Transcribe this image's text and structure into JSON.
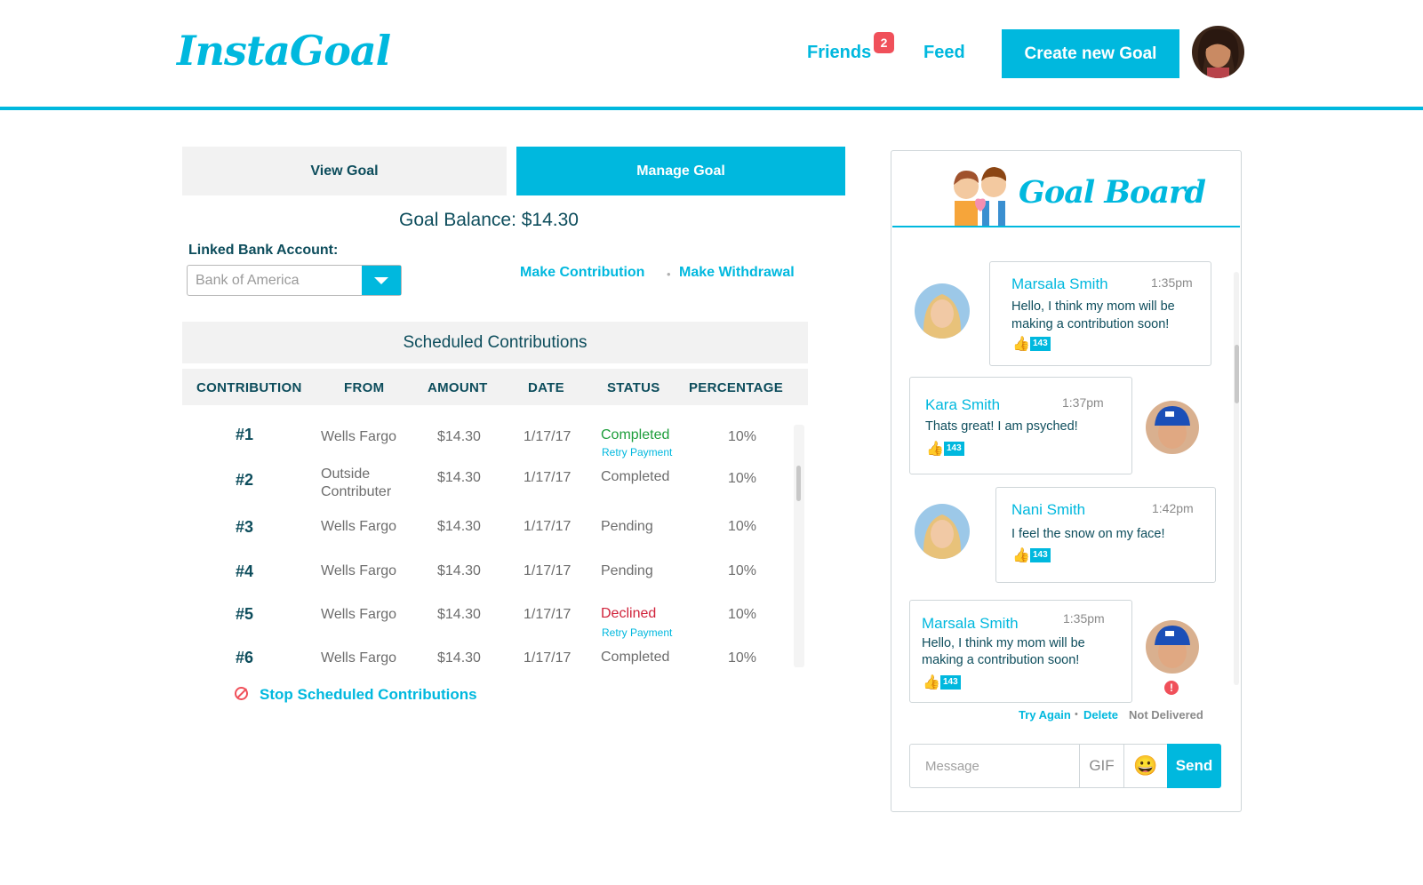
{
  "header": {
    "logo": "InstaGoal",
    "friends_label": "Friends",
    "friends_badge": "2",
    "feed_label": "Feed",
    "create_label": "Create new Goal"
  },
  "tabs": [
    {
      "label": "View Goal",
      "active": false
    },
    {
      "label": "Manage Goal",
      "active": true
    }
  ],
  "goal": {
    "balance": "Goal Balance: $14.30",
    "bank_label": "Linked Bank Account:",
    "bank_value": "Bank of America",
    "make_contribution": "Make Contribution",
    "make_withdrawal": "Make Withdrawal",
    "separator": "•"
  },
  "schedule": {
    "title": "Scheduled Contributions",
    "columns": [
      "CONTRIBUTION",
      "FROM",
      "AMOUNT",
      "DATE",
      "STATUS",
      "PERCENTAGE"
    ],
    "rows": [
      {
        "num": "#1",
        "from": "Wells Fargo",
        "amount": "$14.30",
        "date": "1/17/17",
        "status": "Completed",
        "retry": "Retry Payment",
        "pct": "10%"
      },
      {
        "num": "#2",
        "from_line1": "Outside",
        "from_line2": "Contributer",
        "amount": "$14.30",
        "date": "1/17/17",
        "status": "Completed",
        "pct": "10%"
      },
      {
        "num": "#3",
        "from": "Wells Fargo",
        "amount": "$14.30",
        "date": "1/17/17",
        "status": "Pending",
        "pct": "10%"
      },
      {
        "num": "#4",
        "from": "Wells Fargo",
        "amount": "$14.30",
        "date": "1/17/17",
        "status": "Pending",
        "pct": "10%"
      },
      {
        "num": "#5",
        "from": "Wells Fargo",
        "amount": "$14.30",
        "date": "1/17/17",
        "status": "Declined",
        "retry": "Retry Payment",
        "pct": "10%"
      },
      {
        "num": "#6",
        "from": "Wells Fargo",
        "amount": "$14.30",
        "date": "1/17/17",
        "status": "Completed",
        "pct": "10%"
      }
    ],
    "stop_label": "Stop Scheduled Contributions"
  },
  "board": {
    "title": "Goal Board",
    "messages": [
      {
        "name": "Marsala Smith",
        "time": "1:35pm",
        "line1": "Hello, I think my mom will be",
        "line2": "making a contribution soon!",
        "likes": "143"
      },
      {
        "name": "Kara Smith",
        "time": "1:37pm",
        "line1": "Thats great! I am psyched!",
        "likes": "143"
      },
      {
        "name": "Nani Smith",
        "time": "1:42pm",
        "line1": "I feel the snow on my face!",
        "likes": "143"
      },
      {
        "name": "Marsala Smith",
        "time": "1:35pm",
        "line1": "Hello, I think my mom will be",
        "line2": "making a contribution soon!",
        "likes": "143"
      }
    ],
    "try_again": "Try Again",
    "delete": "Delete",
    "dot": "•",
    "not_delivered": "Not Delivered",
    "error_glyph": "!",
    "composer": {
      "placeholder": "Message",
      "gif": "GIF",
      "emoji": "😀",
      "send": "Send"
    }
  },
  "colors": {
    "accent": "#00b8de",
    "dark_text": "#0d4d5c",
    "green": "#1e9e3c",
    "red": "#d0223a",
    "badge": "#f0505a"
  },
  "icons": [
    "user-avatar-icon",
    "dropdown-arrow-icon",
    "stop-icon",
    "couple-illustration-icon",
    "thumbs-up-icon",
    "error-icon",
    "gif-icon",
    "emoji-icon"
  ]
}
